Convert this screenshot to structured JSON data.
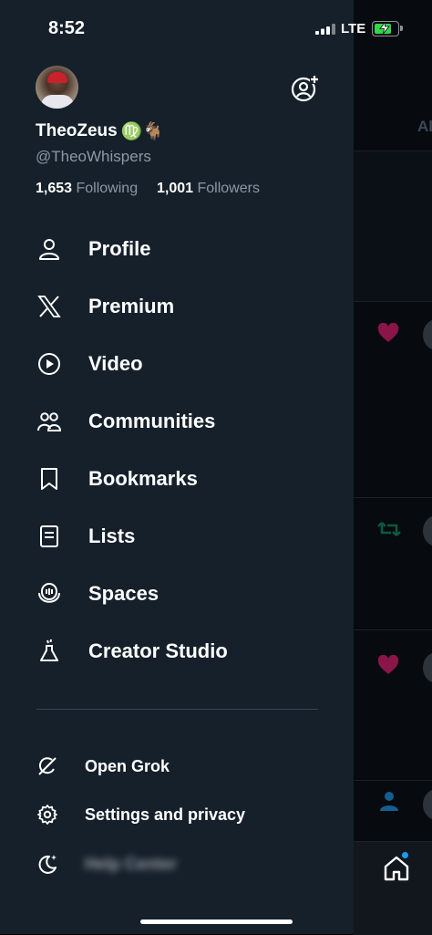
{
  "status_bar": {
    "time": "8:52",
    "network": "LTE",
    "battery_state": "charging"
  },
  "profile": {
    "display_name": "TheoZeus",
    "name_emoji": "♍️🐐",
    "handle": "@TheoWhispers",
    "following_count": "1,653",
    "following_label": "Following",
    "followers_count": "1,001",
    "followers_label": "Followers"
  },
  "menu": {
    "items": [
      {
        "label": "Profile",
        "icon": "person-icon"
      },
      {
        "label": "Premium",
        "icon": "x-logo-icon"
      },
      {
        "label": "Video",
        "icon": "play-circle-icon"
      },
      {
        "label": "Communities",
        "icon": "people-icon"
      },
      {
        "label": "Bookmarks",
        "icon": "bookmark-icon"
      },
      {
        "label": "Lists",
        "icon": "list-icon"
      },
      {
        "label": "Spaces",
        "icon": "microphone-icon"
      },
      {
        "label": "Creator Studio",
        "icon": "flask-icon"
      }
    ]
  },
  "secondary_menu": {
    "items": [
      {
        "label": "Open Grok",
        "icon": "grok-icon"
      },
      {
        "label": "Settings and privacy",
        "icon": "gear-icon"
      },
      {
        "label": "Help Center",
        "icon": "moon-sparkle-icon"
      }
    ]
  },
  "background_timeline": {
    "tab_fragment": "Al",
    "colors": {
      "like": "#f91880",
      "retweet": "#00ba7c",
      "follow": "#1d9bf0"
    }
  },
  "colors": {
    "drawer_bg": "#15202b",
    "accent": "#1d9bf0",
    "secondary_text": "#8b98a5"
  }
}
